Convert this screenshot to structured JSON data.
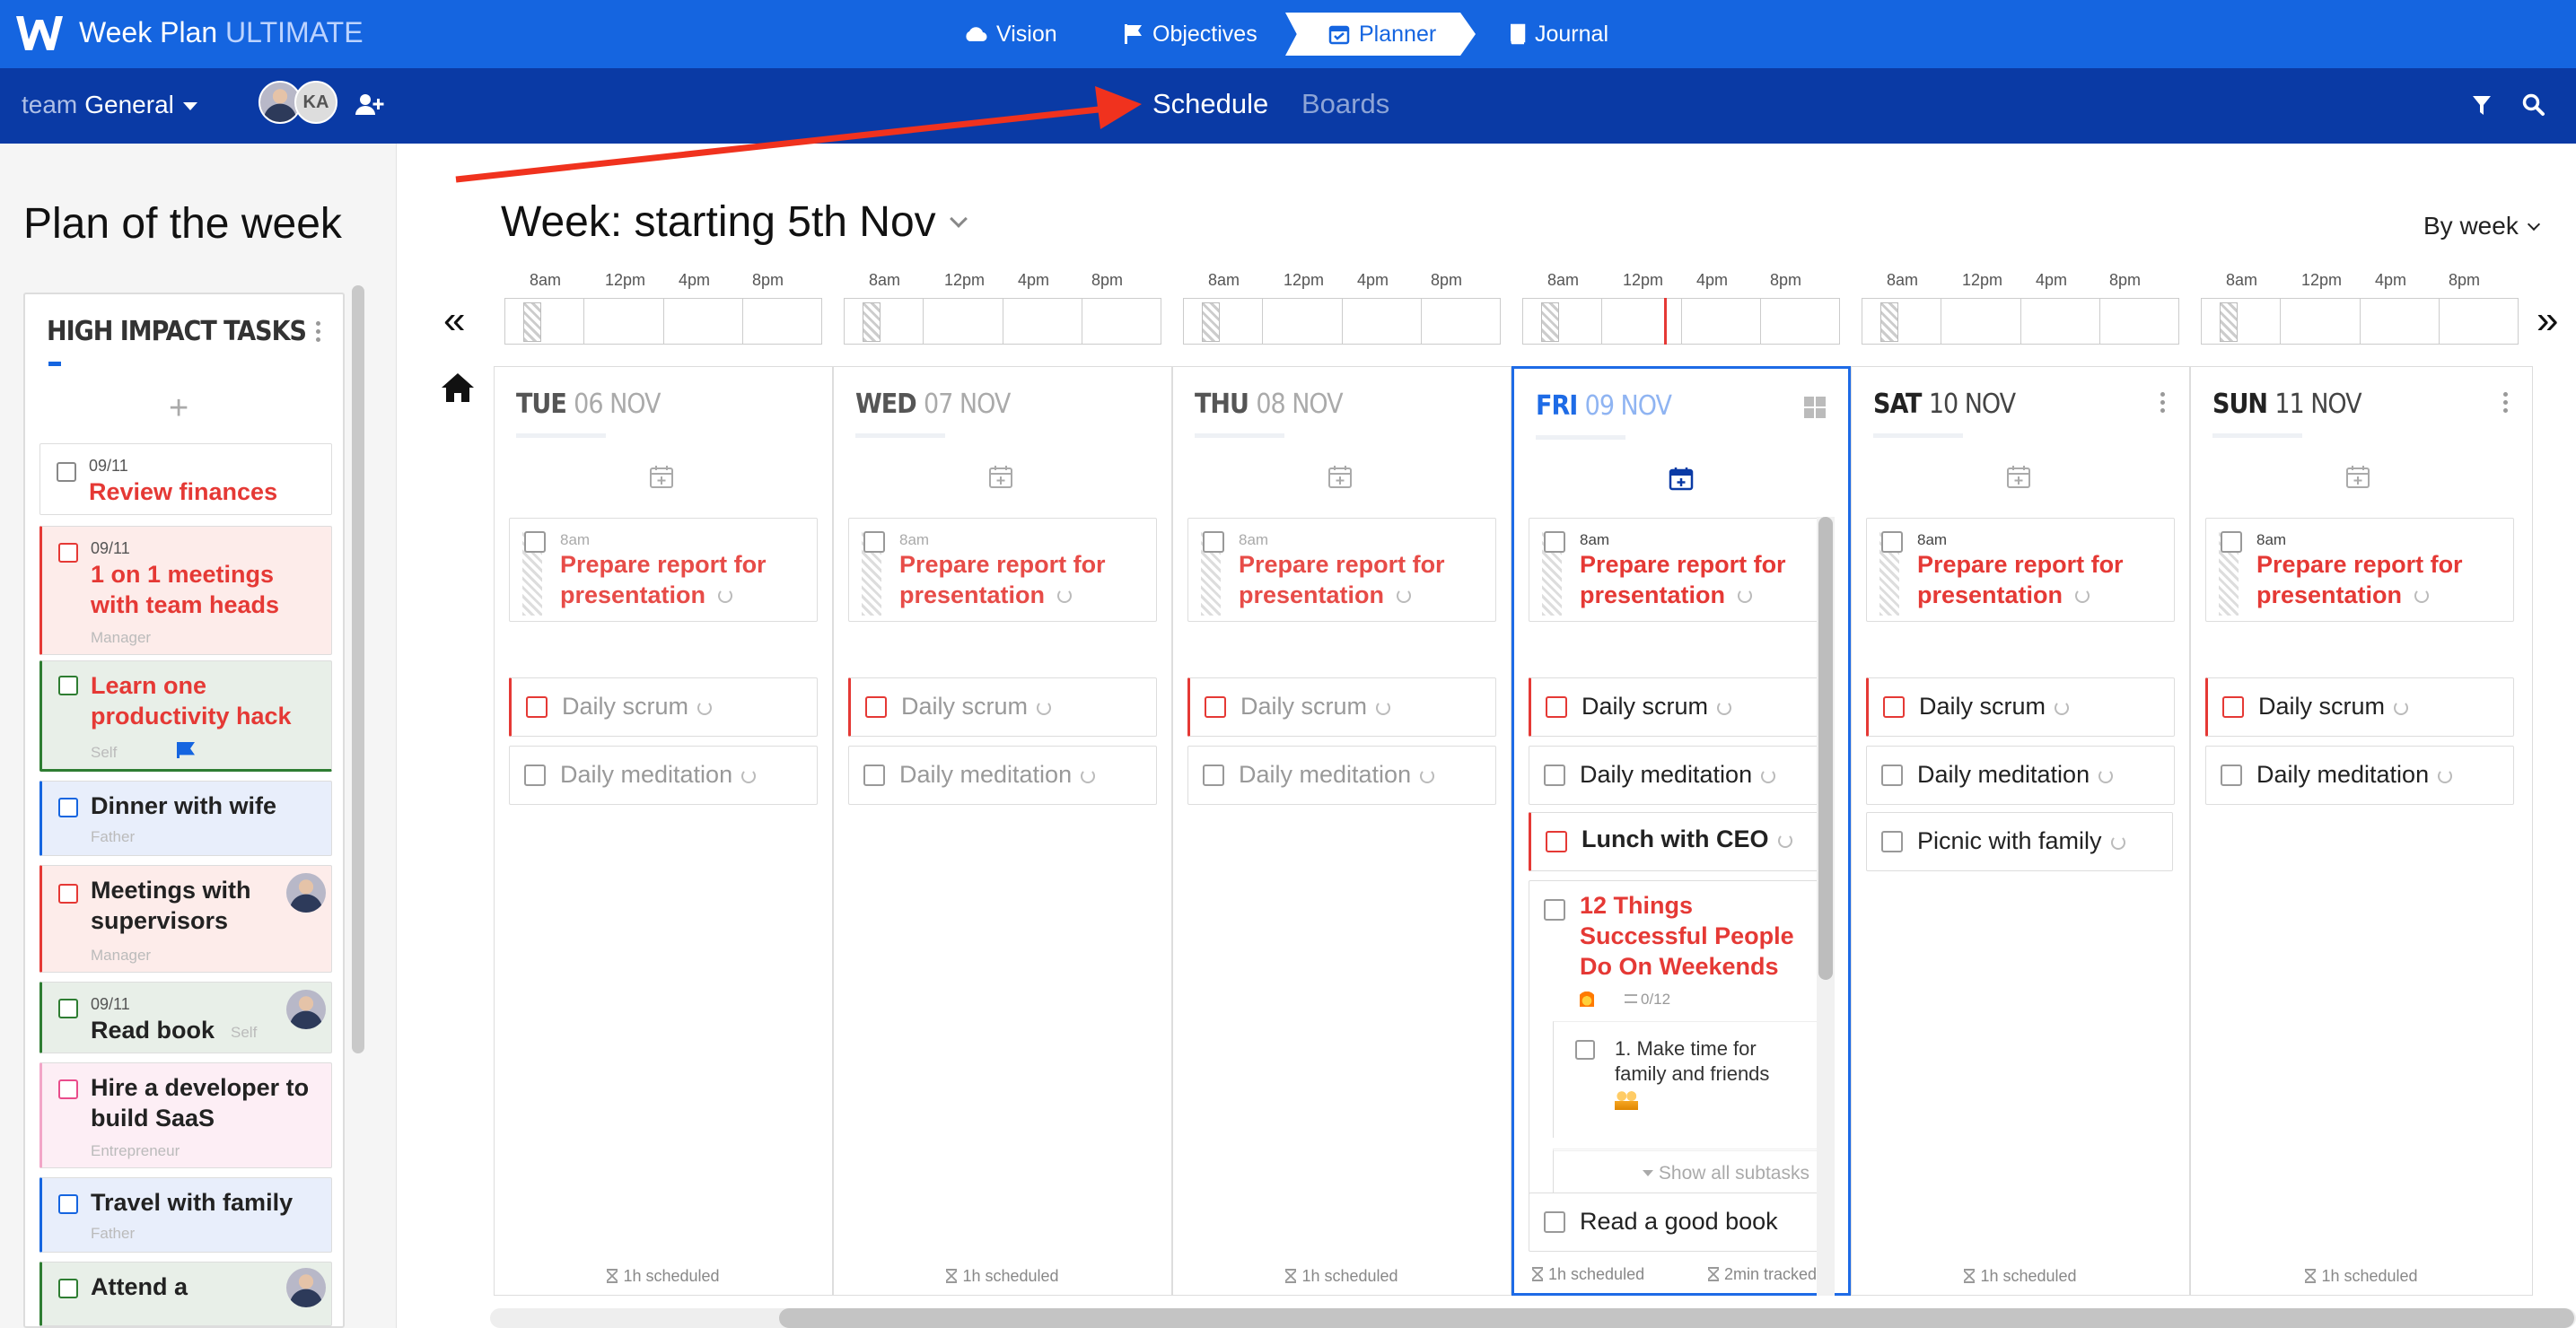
{
  "app": {
    "brand": "Week Plan",
    "edition": "ULTIMATE"
  },
  "nav": {
    "vision": "Vision",
    "objectives": "Objectives",
    "planner": "Planner",
    "journal": "Journal"
  },
  "subbar": {
    "team_label": "team",
    "team_name": "General",
    "avatar_initials": "KA",
    "tabs": {
      "schedule": "Schedule",
      "boards": "Boards"
    }
  },
  "sidebar": {
    "title": "Plan of the week",
    "panel_title": "HIGH IMPACT TASKS",
    "add_symbol": "+",
    "items": [
      {
        "date": "09/11",
        "title": "Review finances",
        "role": ""
      },
      {
        "date": "09/11",
        "title": "1 on 1 meetings with team heads",
        "role": "Manager"
      },
      {
        "date": "",
        "title": "Learn one productivity hack",
        "role": "Self"
      },
      {
        "date": "",
        "title": "Dinner with wife",
        "role": "Father"
      },
      {
        "date": "",
        "title": "Meetings with supervisors",
        "role": "Manager"
      },
      {
        "date": "09/11",
        "title": "Read book",
        "role": "Self"
      },
      {
        "date": "",
        "title": "Hire a developer to build SaaS",
        "role": "Entrepreneur"
      },
      {
        "date": "",
        "title": "Travel with family",
        "role": "Father"
      },
      {
        "date": "",
        "title": "Attend a",
        "role": ""
      }
    ]
  },
  "week": {
    "title": "Week: starting 5th Nov",
    "view_mode": "By week",
    "nav_prev": "«",
    "nav_next": "»"
  },
  "timeline": {
    "labels": [
      "8am",
      "12pm",
      "4pm",
      "8pm"
    ]
  },
  "days": [
    {
      "dow": "TUE",
      "date": "06 NOV"
    },
    {
      "dow": "WED",
      "date": "07 NOV"
    },
    {
      "dow": "THU",
      "date": "08 NOV"
    },
    {
      "dow": "FRI",
      "date": "09 NOV"
    },
    {
      "dow": "SAT",
      "date": "10 NOV"
    },
    {
      "dow": "SUN",
      "date": "11 NOV"
    }
  ],
  "tasks": {
    "prepare_time": "8am",
    "prepare": "Prepare report for presentation",
    "scrum": "Daily scrum",
    "meditation": "Daily meditation",
    "lunch": "Lunch with CEO",
    "things": "12 Things Successful People Do On Weekends",
    "things_progress": "0/12",
    "subtask": "1. Make time for family and friends",
    "show_subtasks": "Show all subtasks",
    "book": "Read a good book",
    "picnic": "Picnic with family"
  },
  "footer": {
    "scheduled": "1h scheduled",
    "tracked": "2min tracked"
  },
  "colors": {
    "primary": "#1565e0",
    "secondary": "#0a3aa5",
    "accent_red": "#e53935"
  }
}
